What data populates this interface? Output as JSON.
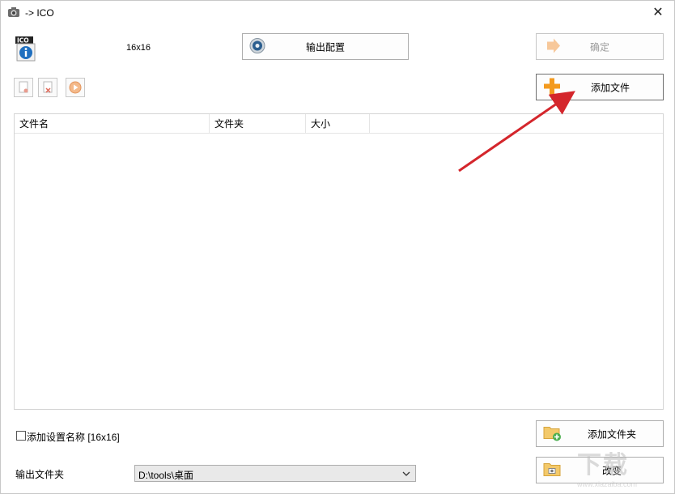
{
  "window": {
    "title": "-> ICO",
    "close_glyph": "✕"
  },
  "header": {
    "size_label": "16x16"
  },
  "buttons": {
    "config": {
      "label": "输出配置",
      "icon": "gear-disc-icon"
    },
    "ok": {
      "label": "确定",
      "icon": "arrow-right-icon",
      "enabled": false
    },
    "add_file": {
      "label": "添加文件",
      "icon": "plus-icon"
    },
    "add_folder": {
      "label": "添加文件夹",
      "icon": "folder-add-icon"
    },
    "change": {
      "label": "改变",
      "icon": "folder-photo-icon"
    }
  },
  "toolbar": {
    "items": [
      {
        "icon": "clear-doc-icon"
      },
      {
        "icon": "remove-doc-icon"
      },
      {
        "icon": "play-icon"
      }
    ]
  },
  "list": {
    "columns": [
      "文件名",
      "文件夹",
      "大小"
    ],
    "rows": []
  },
  "options": {
    "add_preset_name": {
      "label": "添加设置名称 [16x16]",
      "checked": false
    }
  },
  "output": {
    "label": "输出文件夹",
    "folder_value": "D:\\tools\\桌面"
  },
  "annotation": {
    "arrow_color": "#d4262c"
  },
  "watermark": {
    "text": "下载",
    "url": "www.xiazaiba.com"
  },
  "colors": {
    "accent_orange": "#f39a1e",
    "disabled_text": "#9a9a9a"
  }
}
